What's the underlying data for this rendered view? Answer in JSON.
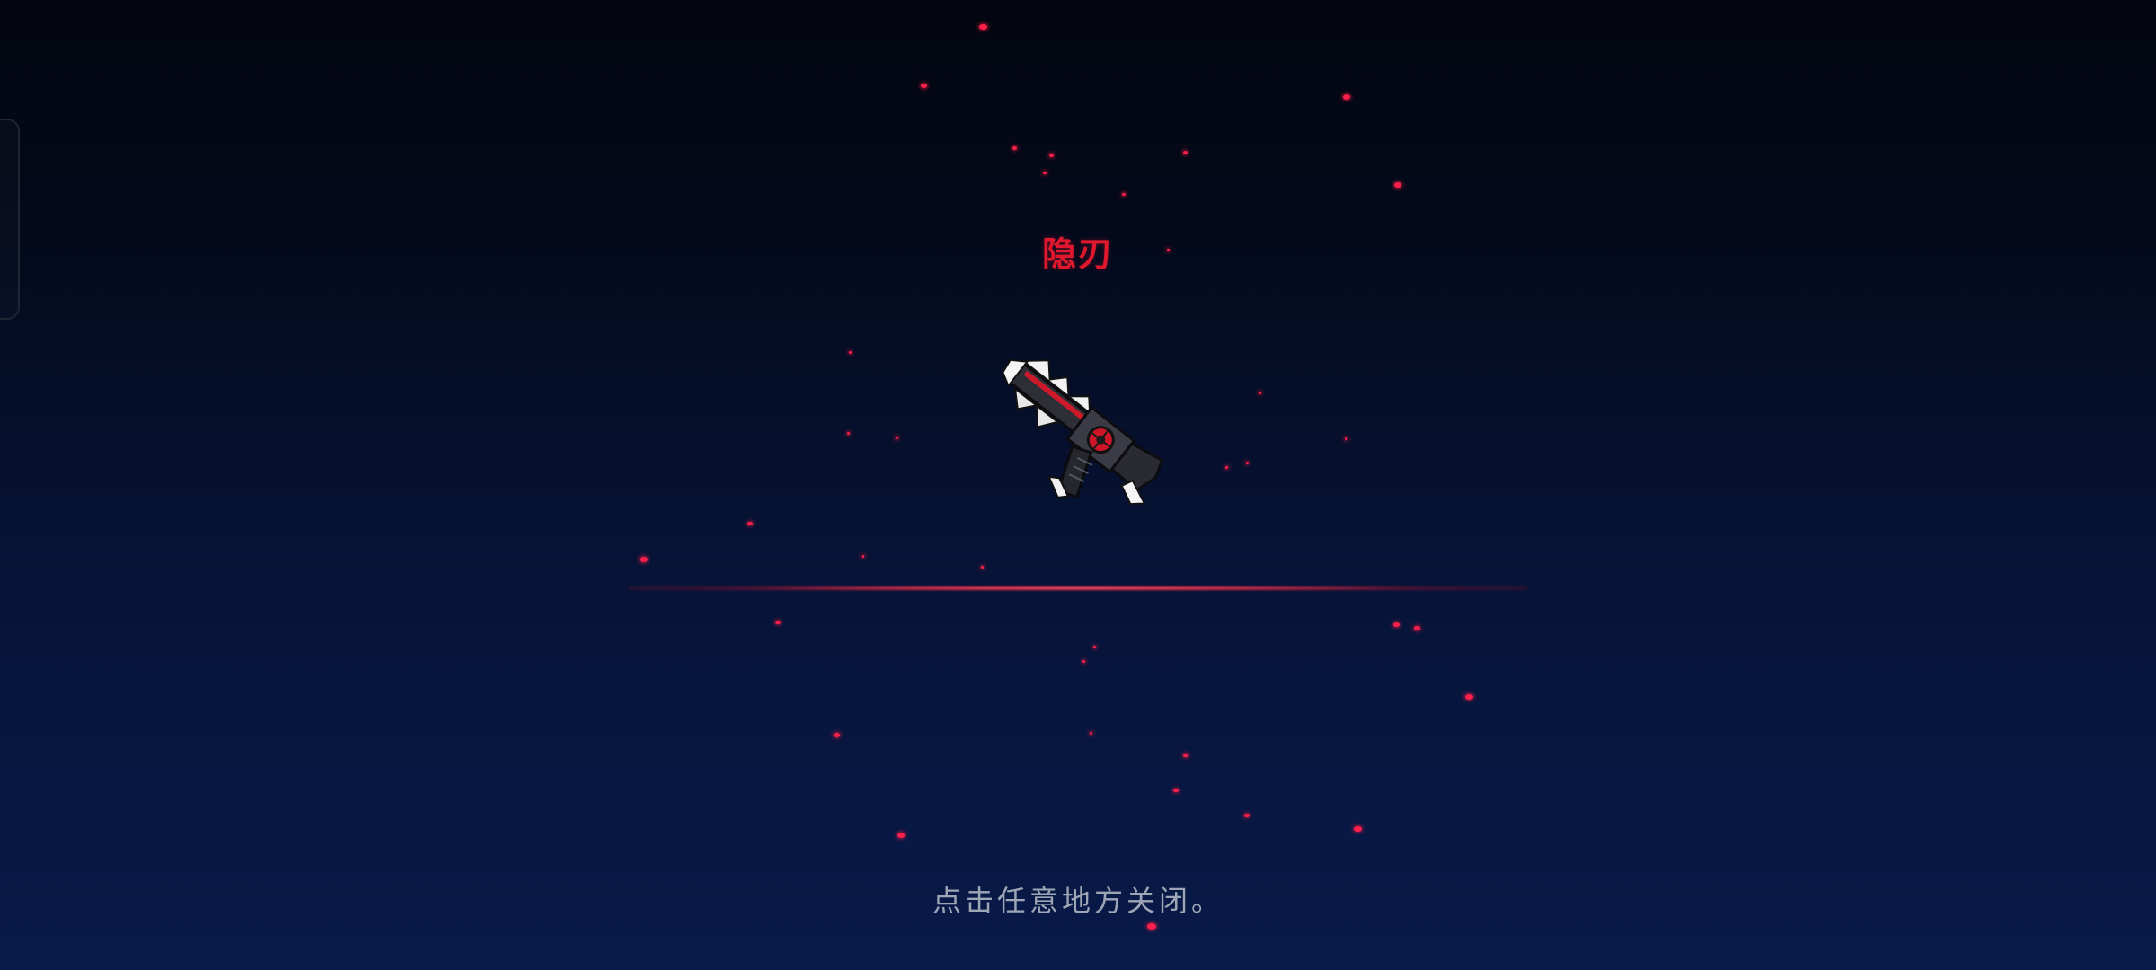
{
  "reward_popup": {
    "item_name": "隐刃",
    "close_hint": "点击任意地方关闭。"
  },
  "colors": {
    "item_name": "#e0182d",
    "glow_line": "#ff1e3c",
    "particles": "#ff1f4b",
    "hint_text": "#9ea6b5",
    "background_top": "#03060f",
    "background_bottom": "#081a4a"
  },
  "icons": {
    "weapon": "weapon-gun-icon"
  }
}
